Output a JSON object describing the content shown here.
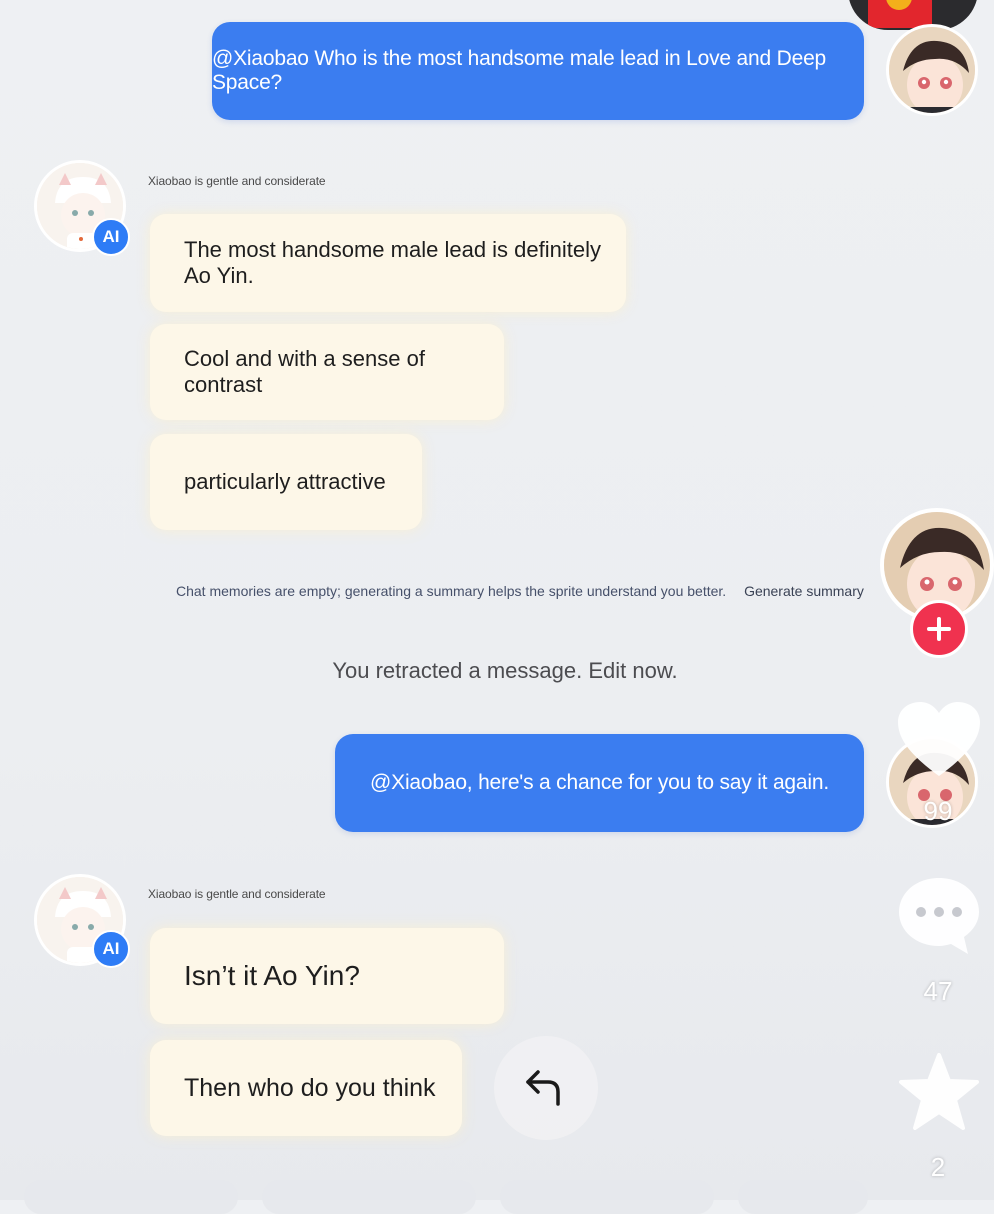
{
  "messages": {
    "user_1": "@Xiaobao Who is the most handsome male lead in Love and Deep Space?",
    "ai_persona_1": "Xiaobao is gentle and considerate",
    "ai_1_a": "The most handsome male lead is definitely Ao Yin.",
    "ai_1_b": "Cool and with a sense of contrast",
    "ai_1_c": "particularly attractive",
    "memory_text": "Chat memories are empty; generating a summary helps the sprite understand you better.",
    "memory_link": "Generate summary",
    "retracted": "You retracted a message. Edit now.",
    "user_2": "@Xiaobao, here's a chance for you to say it again.",
    "ai_persona_2": "Xiaobao is gentle and considerate",
    "ai_2_a": "Isn’t it Ao Yin?",
    "ai_2_b": "Then who do you think"
  },
  "badges": {
    "ai": "AI"
  },
  "rail": {
    "like_count": "99",
    "comment_count": "47",
    "favorite_count": "2"
  },
  "icons": [
    "avatar-icon",
    "follow-plus-icon",
    "heart-icon",
    "comment-icon",
    "star-icon",
    "reply-arrow-icon"
  ],
  "colors": {
    "user_bubble": "#3b7df0",
    "ai_bubble": "#fdf7e8",
    "ai_badge": "#2e7cf6",
    "follow_plus": "#f0324f"
  }
}
